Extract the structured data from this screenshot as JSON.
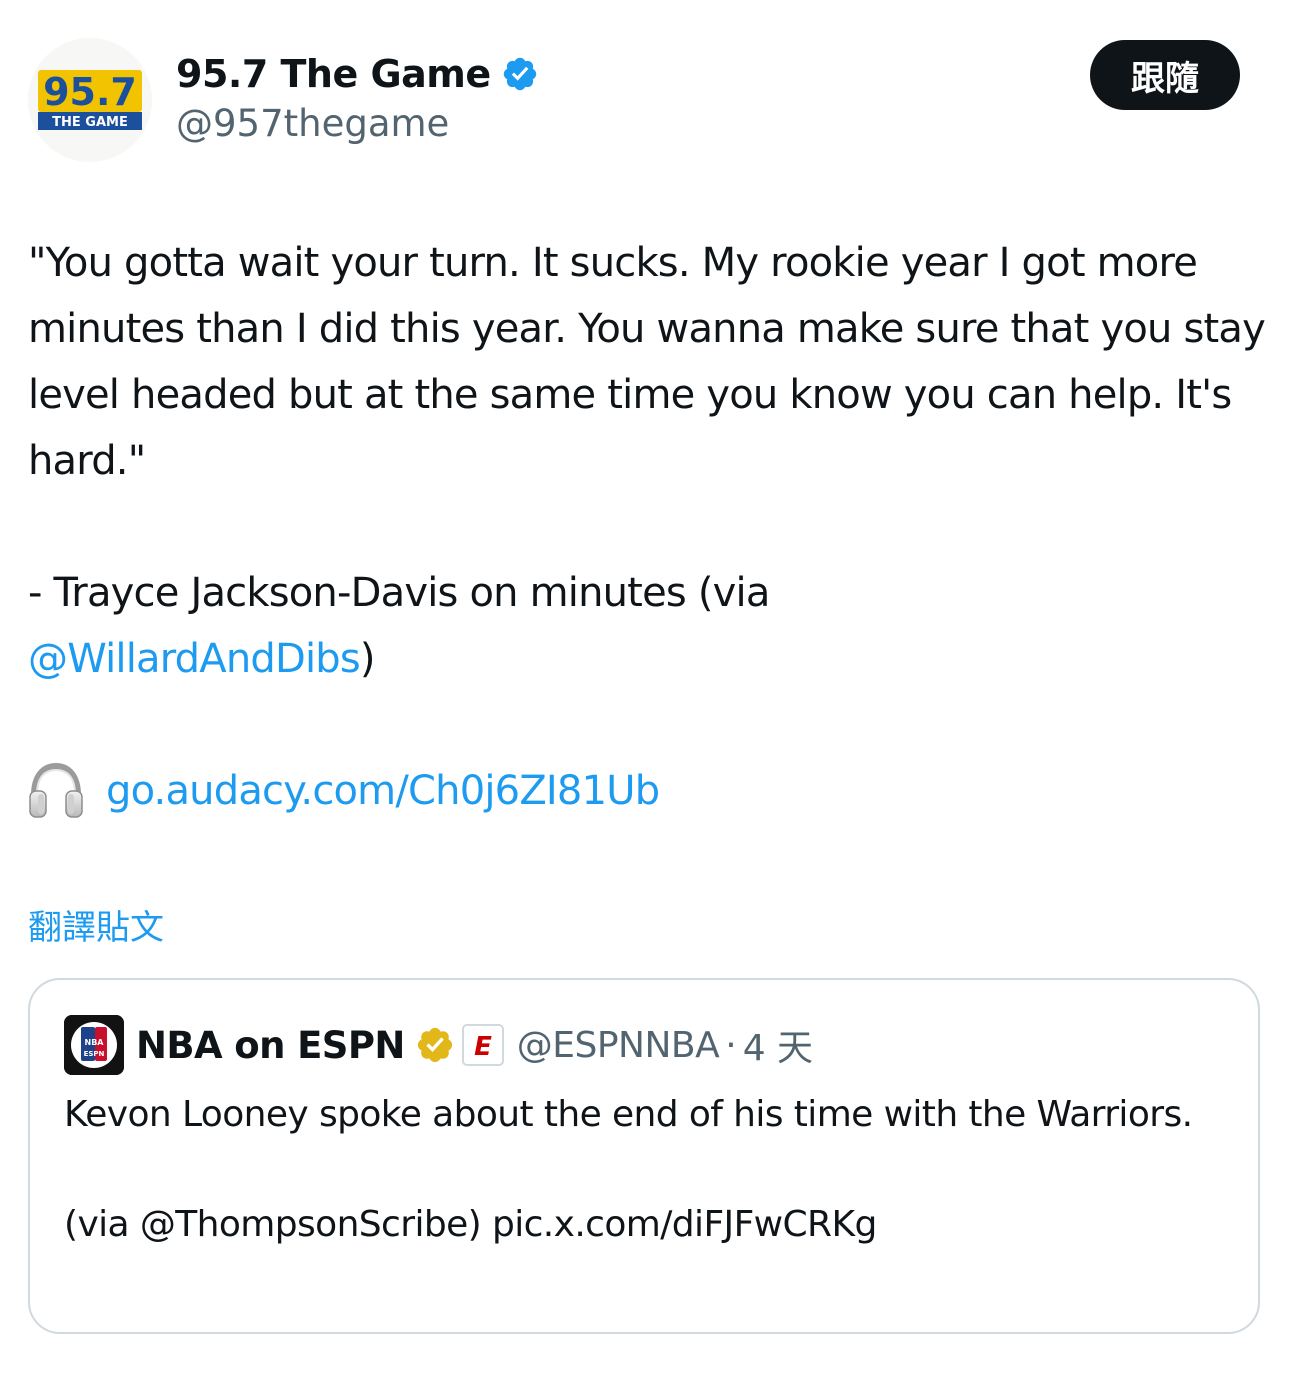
{
  "author": {
    "display_name": "95.7 The Game",
    "handle": "@957thegame",
    "avatar_text_top": "95.7",
    "avatar_text_bottom": "THE GAME",
    "verified_icon": "blue-verified-check-icon"
  },
  "follow_button": {
    "label": "跟隨"
  },
  "tweet": {
    "quote_lines": "\"You gotta wait your turn. It sucks. My rookie year I got more minutes than I did this year. You wanna make sure that you stay level headed but at the same time you know you can help. It's hard.\"",
    "attribution_prefix": "- Trayce Jackson-Davis on minutes (via",
    "mention": "@WillardAndDibs",
    "attribution_suffix": ")",
    "audio_icon": "headphones-icon",
    "audio_link": "go.audacy.com/Ch0j6ZI81Ub"
  },
  "translate_label": "翻譯貼文",
  "quoted_tweet": {
    "display_name": "NBA on ESPN",
    "handle": "@ESPNNBA",
    "separator": "·",
    "time": "4 天",
    "avatar_text_top": "NBA",
    "avatar_text_bottom": "ESPN",
    "badge_letter": "E",
    "text_line1": "Kevon Looney spoke about the end of his time with the Warriors.",
    "text_line2": "(via @ThompsonScribe) pic.x.com/diFJFwCRKg"
  },
  "colors": {
    "link": "#1d9bf0",
    "text": "#0f1419",
    "secondary": "#536471",
    "verified_blue": "#1d9bf0",
    "verified_gold": "#e2b719",
    "border": "#cfd9de",
    "button_bg": "#0f1419"
  }
}
